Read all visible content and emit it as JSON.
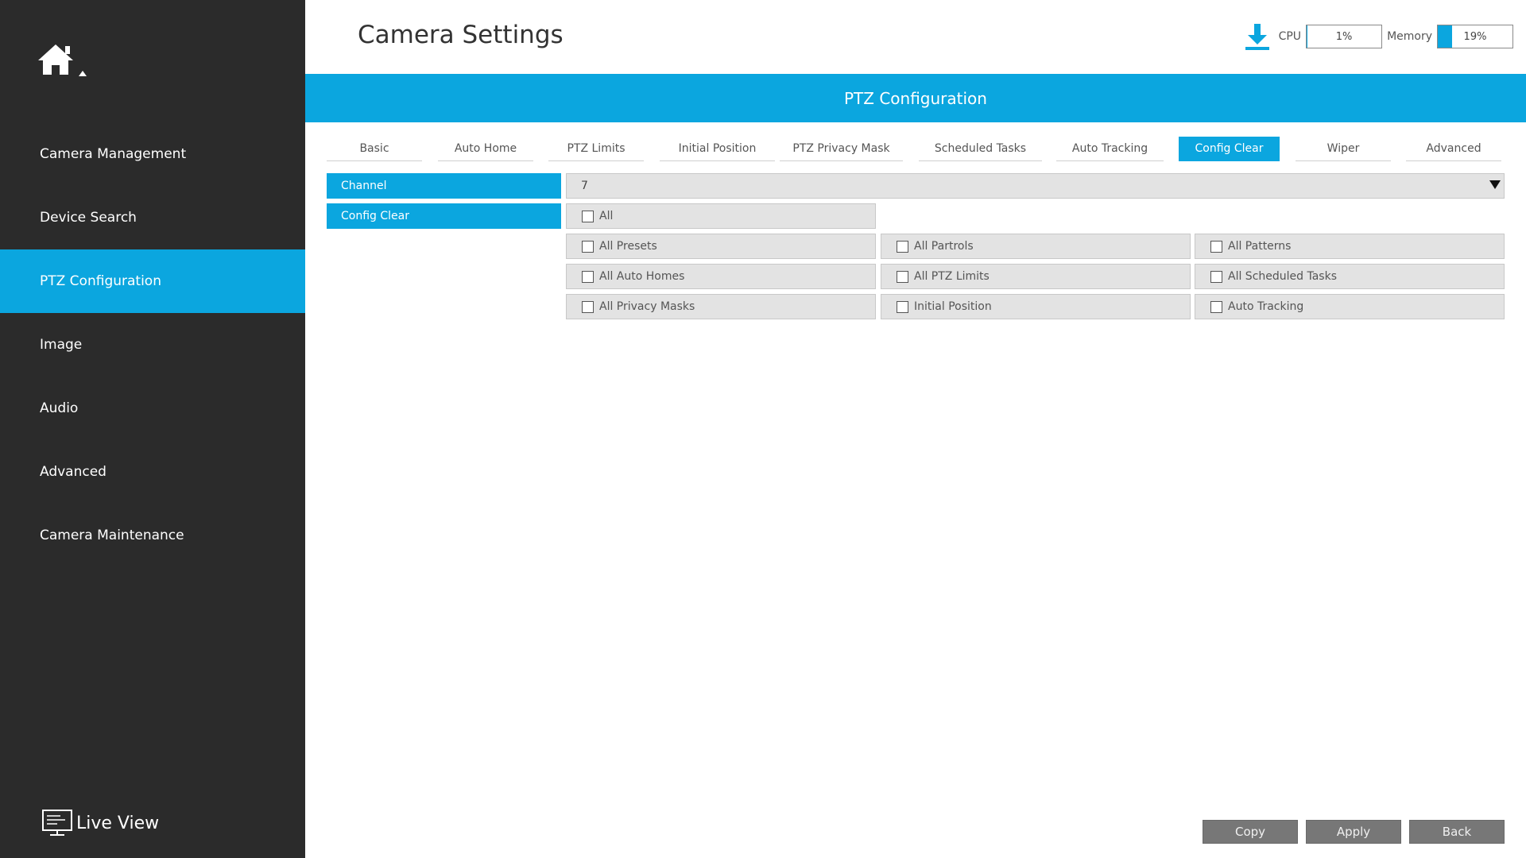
{
  "sidebar": {
    "home_icon": "home-icon",
    "items": [
      {
        "label": "Camera Management",
        "active": false
      },
      {
        "label": "Device Search",
        "active": false
      },
      {
        "label": "PTZ Configuration",
        "active": true
      },
      {
        "label": "Image",
        "active": false
      },
      {
        "label": "Audio",
        "active": false
      },
      {
        "label": "Advanced",
        "active": false
      },
      {
        "label": "Camera Maintenance",
        "active": false
      }
    ],
    "live_view_label": "Live View",
    "live_view_icon": "monitor-icon"
  },
  "header": {
    "title": "Camera Settings",
    "download_icon": "download-icon",
    "cpu_label": "CPU",
    "cpu_value": "1%",
    "cpu_percent": 1,
    "memory_label": "Memory",
    "memory_value": "19%",
    "memory_percent": 19
  },
  "banner": {
    "title": "PTZ Configuration"
  },
  "tabs": [
    {
      "label": "Basic",
      "active": false
    },
    {
      "label": "Auto Home",
      "active": false
    },
    {
      "label": "PTZ Limits",
      "active": false
    },
    {
      "label": "Initial Position",
      "active": false
    },
    {
      "label": "PTZ Privacy Mask",
      "active": false
    },
    {
      "label": "Scheduled Tasks",
      "active": false
    },
    {
      "label": "Auto Tracking",
      "active": false
    },
    {
      "label": "Config Clear",
      "active": true
    },
    {
      "label": "Wiper",
      "active": false
    },
    {
      "label": "Advanced",
      "active": false
    }
  ],
  "form": {
    "channel_label": "Channel",
    "channel_value": "7",
    "config_clear_label": "Config Clear",
    "options": {
      "all": {
        "label": "All",
        "checked": false
      },
      "all_presets": {
        "label": "All Presets",
        "checked": false
      },
      "all_partrols": {
        "label": "All Partrols",
        "checked": false
      },
      "all_patterns": {
        "label": "All Patterns",
        "checked": false
      },
      "all_auto_homes": {
        "label": "All Auto Homes",
        "checked": false
      },
      "all_ptz_limits": {
        "label": "All PTZ Limits",
        "checked": false
      },
      "all_scheduled_tasks": {
        "label": "All Scheduled Tasks",
        "checked": false
      },
      "all_privacy_masks": {
        "label": "All Privacy Masks",
        "checked": false
      },
      "initial_position": {
        "label": "Initial Position",
        "checked": false
      },
      "auto_tracking": {
        "label": "Auto Tracking",
        "checked": false
      }
    }
  },
  "footer": {
    "copy_label": "Copy",
    "apply_label": "Apply",
    "back_label": "Back"
  },
  "colors": {
    "accent": "#0ba6df",
    "sidebar_bg": "#2b2b2b",
    "button_bg": "#777777"
  }
}
